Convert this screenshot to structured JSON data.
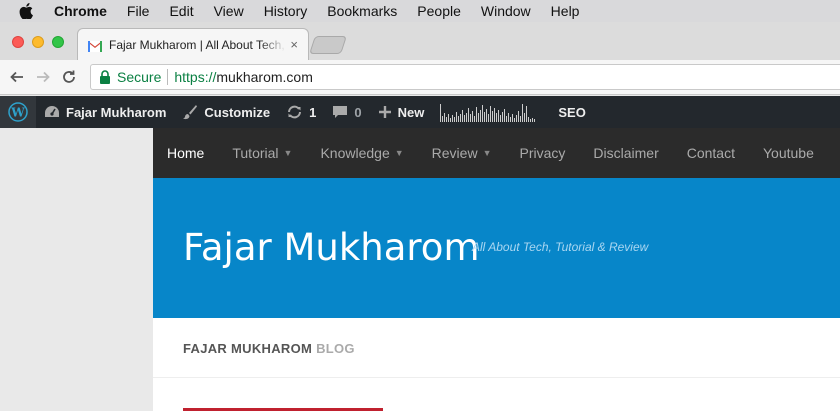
{
  "menubar": {
    "app_name": "Chrome",
    "items": [
      "File",
      "Edit",
      "View",
      "History",
      "Bookmarks",
      "People",
      "Window",
      "Help"
    ]
  },
  "tab": {
    "title": "Fajar Mukharom | All About Tech, Tutorial & Review",
    "close": "×"
  },
  "toolbar": {
    "secure_label": "Secure",
    "url_scheme": "https://",
    "url_host": "mukharom.com"
  },
  "adminbar": {
    "site_name": "Fajar Mukharom",
    "customize": "Customize",
    "updates_count": "1",
    "comments_count": "0",
    "new_label": "New",
    "seo_label": "SEO",
    "stats_icon": "sparkline-graph"
  },
  "sitenav": {
    "items": [
      {
        "label": "Home",
        "dropdown": false,
        "active": true
      },
      {
        "label": "Tutorial",
        "dropdown": true,
        "active": false
      },
      {
        "label": "Knowledge",
        "dropdown": true,
        "active": false
      },
      {
        "label": "Review",
        "dropdown": true,
        "active": false
      },
      {
        "label": "Privacy",
        "dropdown": false,
        "active": false
      },
      {
        "label": "Disclaimer",
        "dropdown": false,
        "active": false
      },
      {
        "label": "Contact",
        "dropdown": false,
        "active": false
      },
      {
        "label": "Youtube",
        "dropdown": false,
        "active": false
      }
    ]
  },
  "header": {
    "site_title": "Fajar Mukharom",
    "tagline": "All About Tech, Tutorial & Review"
  },
  "content": {
    "blog_label_part1": "FAJAR MUKHAROM",
    "blog_label_part2": "BLOG"
  },
  "colors": {
    "header_blue": "#0786c9",
    "adminbar": "#23282d",
    "nav": "#2b2b2b",
    "accent_red": "#c0212f",
    "secure_green": "#0b8043"
  }
}
